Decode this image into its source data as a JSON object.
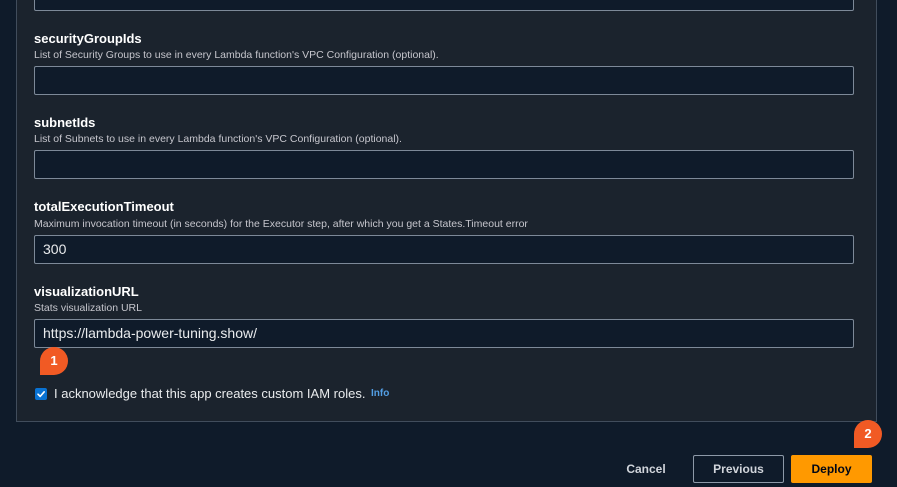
{
  "fields": [
    {
      "name": "securityGroupIds",
      "description": "List of Security Groups to use in every Lambda function's VPC Configuration (optional).",
      "value": ""
    },
    {
      "name": "subnetIds",
      "description": "List of Subnets to use in every Lambda function's VPC Configuration (optional).",
      "value": ""
    },
    {
      "name": "totalExecutionTimeout",
      "description": "Maximum invocation timeout (in seconds) for the Executor step, after which you get a States.Timeout error",
      "value": "300"
    },
    {
      "name": "visualizationURL",
      "description": "Stats visualization URL",
      "value": "https://lambda-power-tuning.show/"
    }
  ],
  "acknowledge": {
    "label": "I acknowledge that this app creates custom IAM roles.",
    "info_link": "Info",
    "checked": true
  },
  "badges": {
    "one": "1",
    "two": "2"
  },
  "buttons": {
    "cancel": "Cancel",
    "previous": "Previous",
    "deploy": "Deploy"
  },
  "colors": {
    "background": "#0f1b2a",
    "panel": "#1b232d",
    "accent": "#ff9900",
    "badge": "#f15a24",
    "link": "#539fe5",
    "checkbox": "#0972d3"
  }
}
